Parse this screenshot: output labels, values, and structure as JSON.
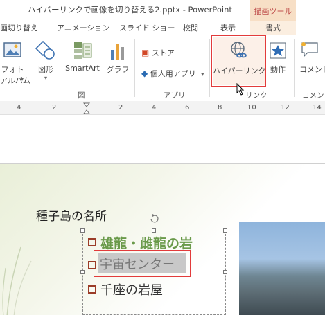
{
  "title": {
    "window_title": "ハイパーリンクで画像を切り替える2.pptx - PowerPoint",
    "context_tab_group": "描画ツール"
  },
  "tabs": [
    "画切り替え",
    "アニメーション",
    "スライド ショー",
    "校閲",
    "表示",
    "書式"
  ],
  "ribbon": {
    "groups": {
      "illustration": "図",
      "apps": "アプリ",
      "links": "リンク",
      "comments": "コメント"
    },
    "photo_album": [
      "フォト",
      "アルバム"
    ],
    "shapes": "図形",
    "smartart": "SmartArt",
    "graph": "グラフ",
    "store": "ストア",
    "personal_apps": "個人用アプリ",
    "hyperlink": "ハイパーリンク",
    "action": "動作",
    "comment": "コメント"
  },
  "ruler": [
    "4",
    "2",
    "2",
    "4",
    "6",
    "8",
    "10",
    "12",
    "14"
  ],
  "slide": {
    "title": "種子島の名所",
    "bullets": [
      "雄龍・雌龍の岩",
      "宇宙センター",
      "千座の岩屋"
    ]
  },
  "colors": {
    "accent_orange": "#c0504d",
    "highlight_red": "#e23b3b",
    "bullet_brown": "#9b3c28",
    "bullet1_green": "#6a9a4a"
  }
}
